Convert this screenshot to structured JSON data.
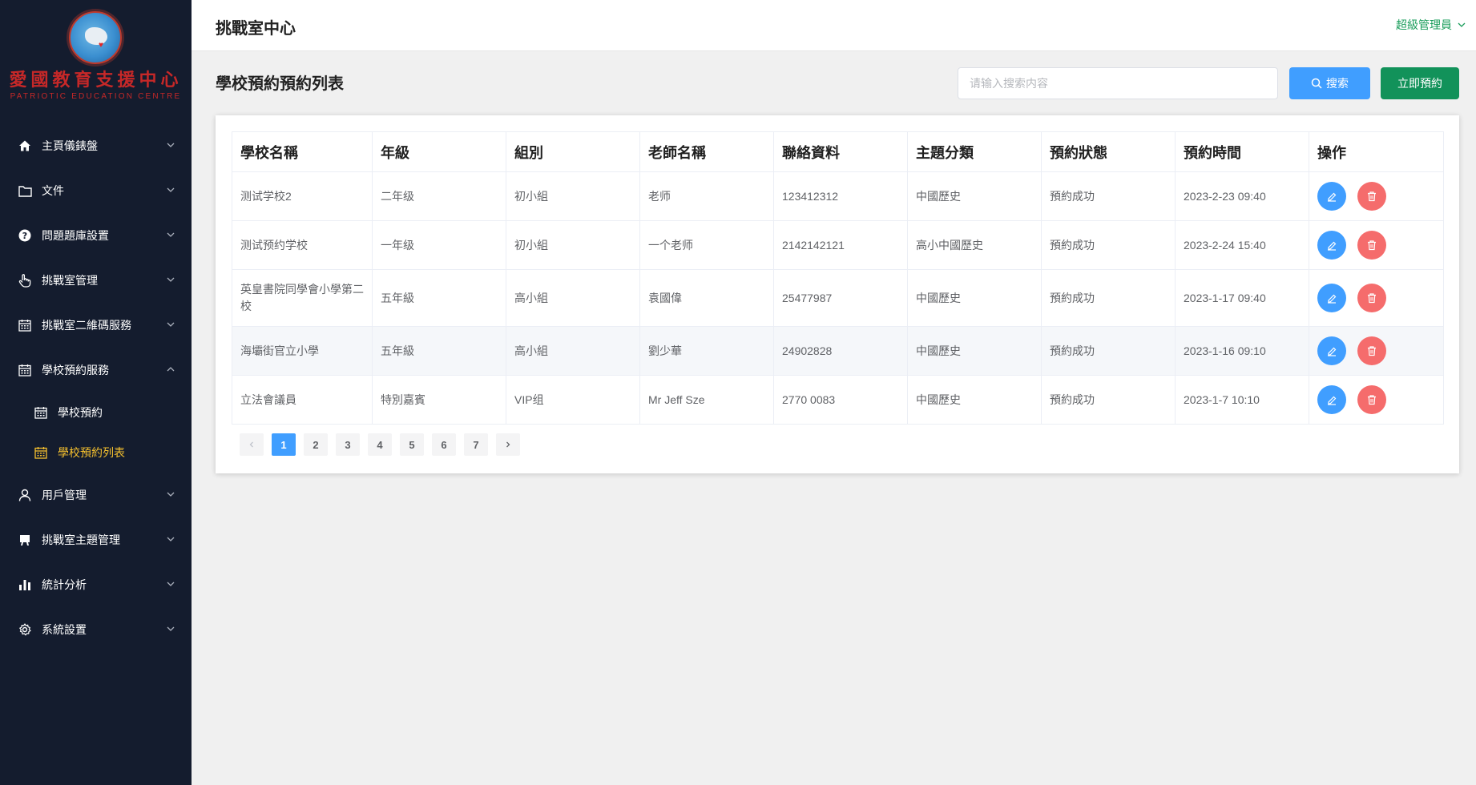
{
  "logo": {
    "title": "愛國教育支援中心",
    "subtitle": "PATRIOTIC EDUCATION CENTRE"
  },
  "sidebar": {
    "items": [
      {
        "label": "主頁儀錶盤",
        "icon": "home-icon"
      },
      {
        "label": "文件",
        "icon": "folder-icon"
      },
      {
        "label": "問題題庫設置",
        "icon": "question-icon"
      },
      {
        "label": "挑戰室管理",
        "icon": "hand-icon"
      },
      {
        "label": "挑戰室二維碼服務",
        "icon": "calendar-icon"
      },
      {
        "label": "學校預約服務",
        "icon": "calendar-icon",
        "expanded": true
      },
      {
        "label": "用戶管理",
        "icon": "user-icon"
      },
      {
        "label": "挑戰室主題管理",
        "icon": "theme-icon"
      },
      {
        "label": "統計分析",
        "icon": "chart-icon"
      },
      {
        "label": "系統設置",
        "icon": "gear-icon"
      }
    ],
    "subitems": [
      {
        "label": "學校預約",
        "icon": "calendar-icon",
        "active": false
      },
      {
        "label": "學校預約列表",
        "icon": "calendar-icon",
        "active": true
      }
    ]
  },
  "header": {
    "title": "挑戰室中心",
    "user": "超級管理員"
  },
  "page": {
    "title": "學校預約預約列表"
  },
  "search": {
    "placeholder": "请输入搜索内容",
    "button": "搜索"
  },
  "actions": {
    "book_now": "立即預約"
  },
  "table": {
    "columns": [
      "學校名稱",
      "年級",
      "組別",
      "老師名稱",
      "聯絡資料",
      "主題分類",
      "預約狀態",
      "預約時間",
      "操作"
    ],
    "rows": [
      [
        "测试学校2",
        "二年级",
        "初小組",
        "老师",
        "123412312",
        "中國歷史",
        "預約成功",
        "2023-2-23 09:40"
      ],
      [
        "测试预约学校",
        "一年级",
        "初小組",
        "一个老师",
        "2142142121",
        "高小中國歷史",
        "預約成功",
        "2023-2-24 15:40"
      ],
      [
        "英皇書院同學會小學第二校",
        "五年級",
        "高小組",
        "袁國偉",
        "25477987",
        "中國歷史",
        "預約成功",
        "2023-1-17 09:40"
      ],
      [
        "海壩街官立小學",
        "五年級",
        "高小組",
        "劉少華",
        "24902828",
        "中國歷史",
        "預約成功",
        "2023-1-16 09:10"
      ],
      [
        "立法會議員",
        "特別嘉賓",
        "VIP组",
        "Mr Jeff Sze",
        "2770 0083",
        "中國歷史",
        "預約成功",
        "2023-1-7 10:10"
      ]
    ]
  },
  "pagination": {
    "pages": [
      "1",
      "2",
      "3",
      "4",
      "5",
      "6",
      "7"
    ],
    "current": "1"
  },
  "colors": {
    "sidebar_bg": "#141c2e",
    "primary": "#409eff",
    "success": "#12925a",
    "danger": "#f56c6c",
    "active_menu": "#f5c02e",
    "logo_red": "#c62828"
  }
}
